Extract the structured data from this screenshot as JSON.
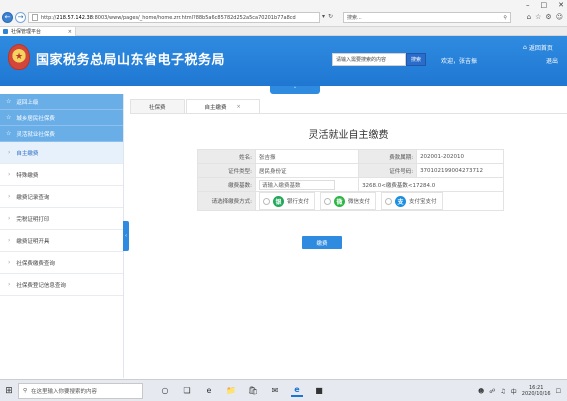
{
  "browser": {
    "url_prefix": "http://",
    "url_host": "218.57.142.38",
    "url_rest": ":8003/www/pages/_home/home.zrr.html?88b5a6c85782d252a5ca70201b77a8cd",
    "search_placeholder": "搜索...",
    "tab_title": "社保管理平台",
    "tab_close": "×",
    "window_controls": [
      "–",
      "□",
      "✕"
    ],
    "right_icons": [
      "⌂",
      "☆",
      "⚙",
      "☺"
    ]
  },
  "header": {
    "site_title": "国家税务总局山东省电子税务局",
    "search_placeholder": "请输入需要搜索的内容",
    "search_button": "搜索",
    "welcome": "欢迎，张吉振",
    "back_home": "返回首页",
    "logout": "退出"
  },
  "sidebar": {
    "sections": [
      {
        "label": "返回上级"
      },
      {
        "label": "城乡居民社保费"
      },
      {
        "label": "灵活就业社保费"
      }
    ],
    "items": [
      {
        "label": "自主缴费",
        "active": true
      },
      {
        "label": "特殊缴费"
      },
      {
        "label": "缴费记录查询"
      },
      {
        "label": "完税证明打印"
      },
      {
        "label": "缴费证明开具"
      },
      {
        "label": "社保费缴费查询"
      },
      {
        "label": "社保费登记信息查询"
      }
    ]
  },
  "tabs": [
    {
      "label": "社保费"
    },
    {
      "label": "自主缴费",
      "active": true,
      "close": "×"
    }
  ],
  "form": {
    "title": "灵活就业自主缴费",
    "name_label": "姓名:",
    "name_value": "张吉振",
    "period_label": "费款属期:",
    "period_value": "202001-202010",
    "idtype_label": "证件类型:",
    "idtype_value": "居民身份证",
    "idno_label": "证件号码:",
    "idno_value": "370102199004273712",
    "base_label": "缴费基数:",
    "base_placeholder": "请输入缴费基数",
    "base_range": "3268.0<缴费基数<17284.0",
    "method_label": "请选择缴费方式:",
    "methods": [
      {
        "label": "银行支付",
        "icon": "bank-icon",
        "glyph": "银"
      },
      {
        "label": "微信支付",
        "icon": "wechat-icon",
        "glyph": "微"
      },
      {
        "label": "支付宝支付",
        "icon": "alipay-icon",
        "glyph": "支"
      }
    ],
    "pay_button": "缴费"
  },
  "taskbar": {
    "search_placeholder": "在这里输入你要搜索的内容",
    "time": "16:21",
    "date": "2020/10/16",
    "ime": "中"
  }
}
